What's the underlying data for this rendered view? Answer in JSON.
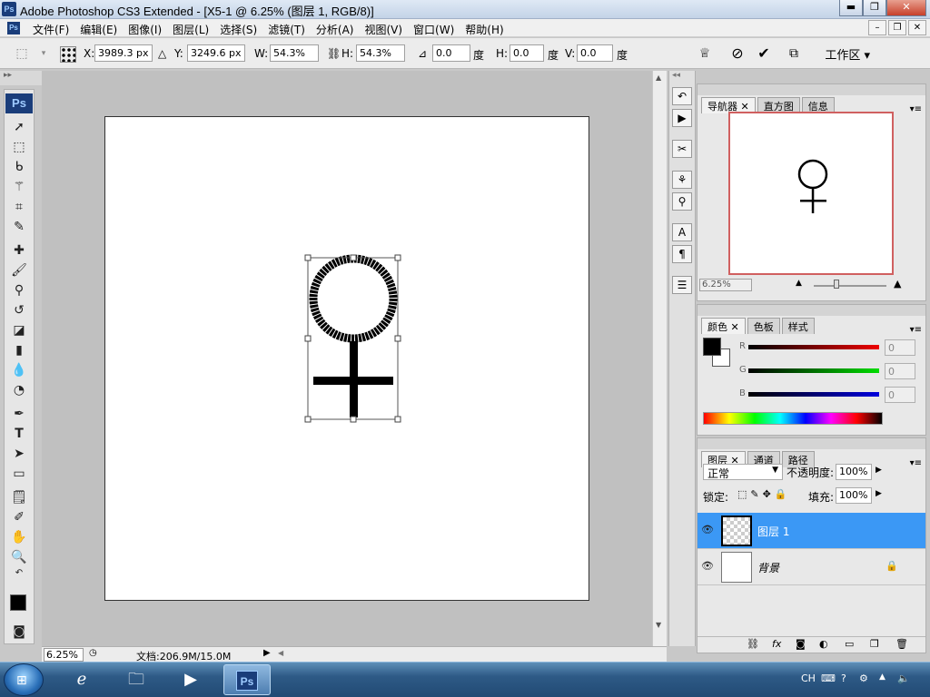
{
  "window": {
    "title": "Adobe Photoshop CS3 Extended - [X5-1 @ 6.25% (图层 1, RGB/8)]",
    "app_icon": "Ps",
    "minimize": "▬",
    "restore": "❐",
    "close": "✕"
  },
  "menubar": {
    "items": [
      "文件(F)",
      "编辑(E)",
      "图像(I)",
      "图层(L)",
      "选择(S)",
      "滤镜(T)",
      "分析(A)",
      "视图(V)",
      "窗口(W)",
      "帮助(H)"
    ],
    "mdi_min": "–",
    "mdi_restore": "❐",
    "mdi_close": "✕"
  },
  "options": {
    "x_label": "X:",
    "x_value": "3989.3 px",
    "y_label": "Y:",
    "y_value": "3249.6 px",
    "w_label": "W:",
    "w_value": "54.3%",
    "h_label": "H:",
    "h_value": "54.3%",
    "angle_value": "0.0",
    "angle_unit": "度",
    "hskew_label": "H:",
    "hskew_value": "0.0",
    "hskew_unit": "度",
    "vskew_label": "V:",
    "vskew_value": "0.0",
    "vskew_unit": "度",
    "workspace": "工作区 ▾"
  },
  "toolbox": {
    "logo": "Ps"
  },
  "status": {
    "zoom": "6.25%",
    "doc_info": "文档:206.9M/15.0M"
  },
  "navigator": {
    "tabs": [
      "导航器",
      "直方图",
      "信息"
    ],
    "zoom": "6.25%"
  },
  "color_panel": {
    "tabs": [
      "颜色",
      "色板",
      "样式"
    ],
    "r_label": "R",
    "g_label": "G",
    "b_label": "B",
    "r_value": "0",
    "g_value": "0",
    "b_value": "0",
    "colors": {
      "r_bar": "#cc0000",
      "g_bar": "#00cc00",
      "b_bar": "#0000cc"
    }
  },
  "layers_panel": {
    "tabs": [
      "图层",
      "通道",
      "路径"
    ],
    "blend_mode": "正常",
    "opacity_label": "不透明度:",
    "opacity_value": "100%",
    "lock_label": "锁定:",
    "fill_label": "填充:",
    "fill_value": "100%",
    "layers": [
      {
        "name": "图层 1",
        "selected": true
      },
      {
        "name": "背景",
        "selected": false
      }
    ]
  },
  "taskbar": {
    "lang": "CH",
    "apps": [
      "ie",
      "explorer",
      "media-player",
      "photoshop"
    ]
  },
  "colors": {
    "selection_blue": "#3b98f5",
    "nav_frame": "#d06060"
  }
}
